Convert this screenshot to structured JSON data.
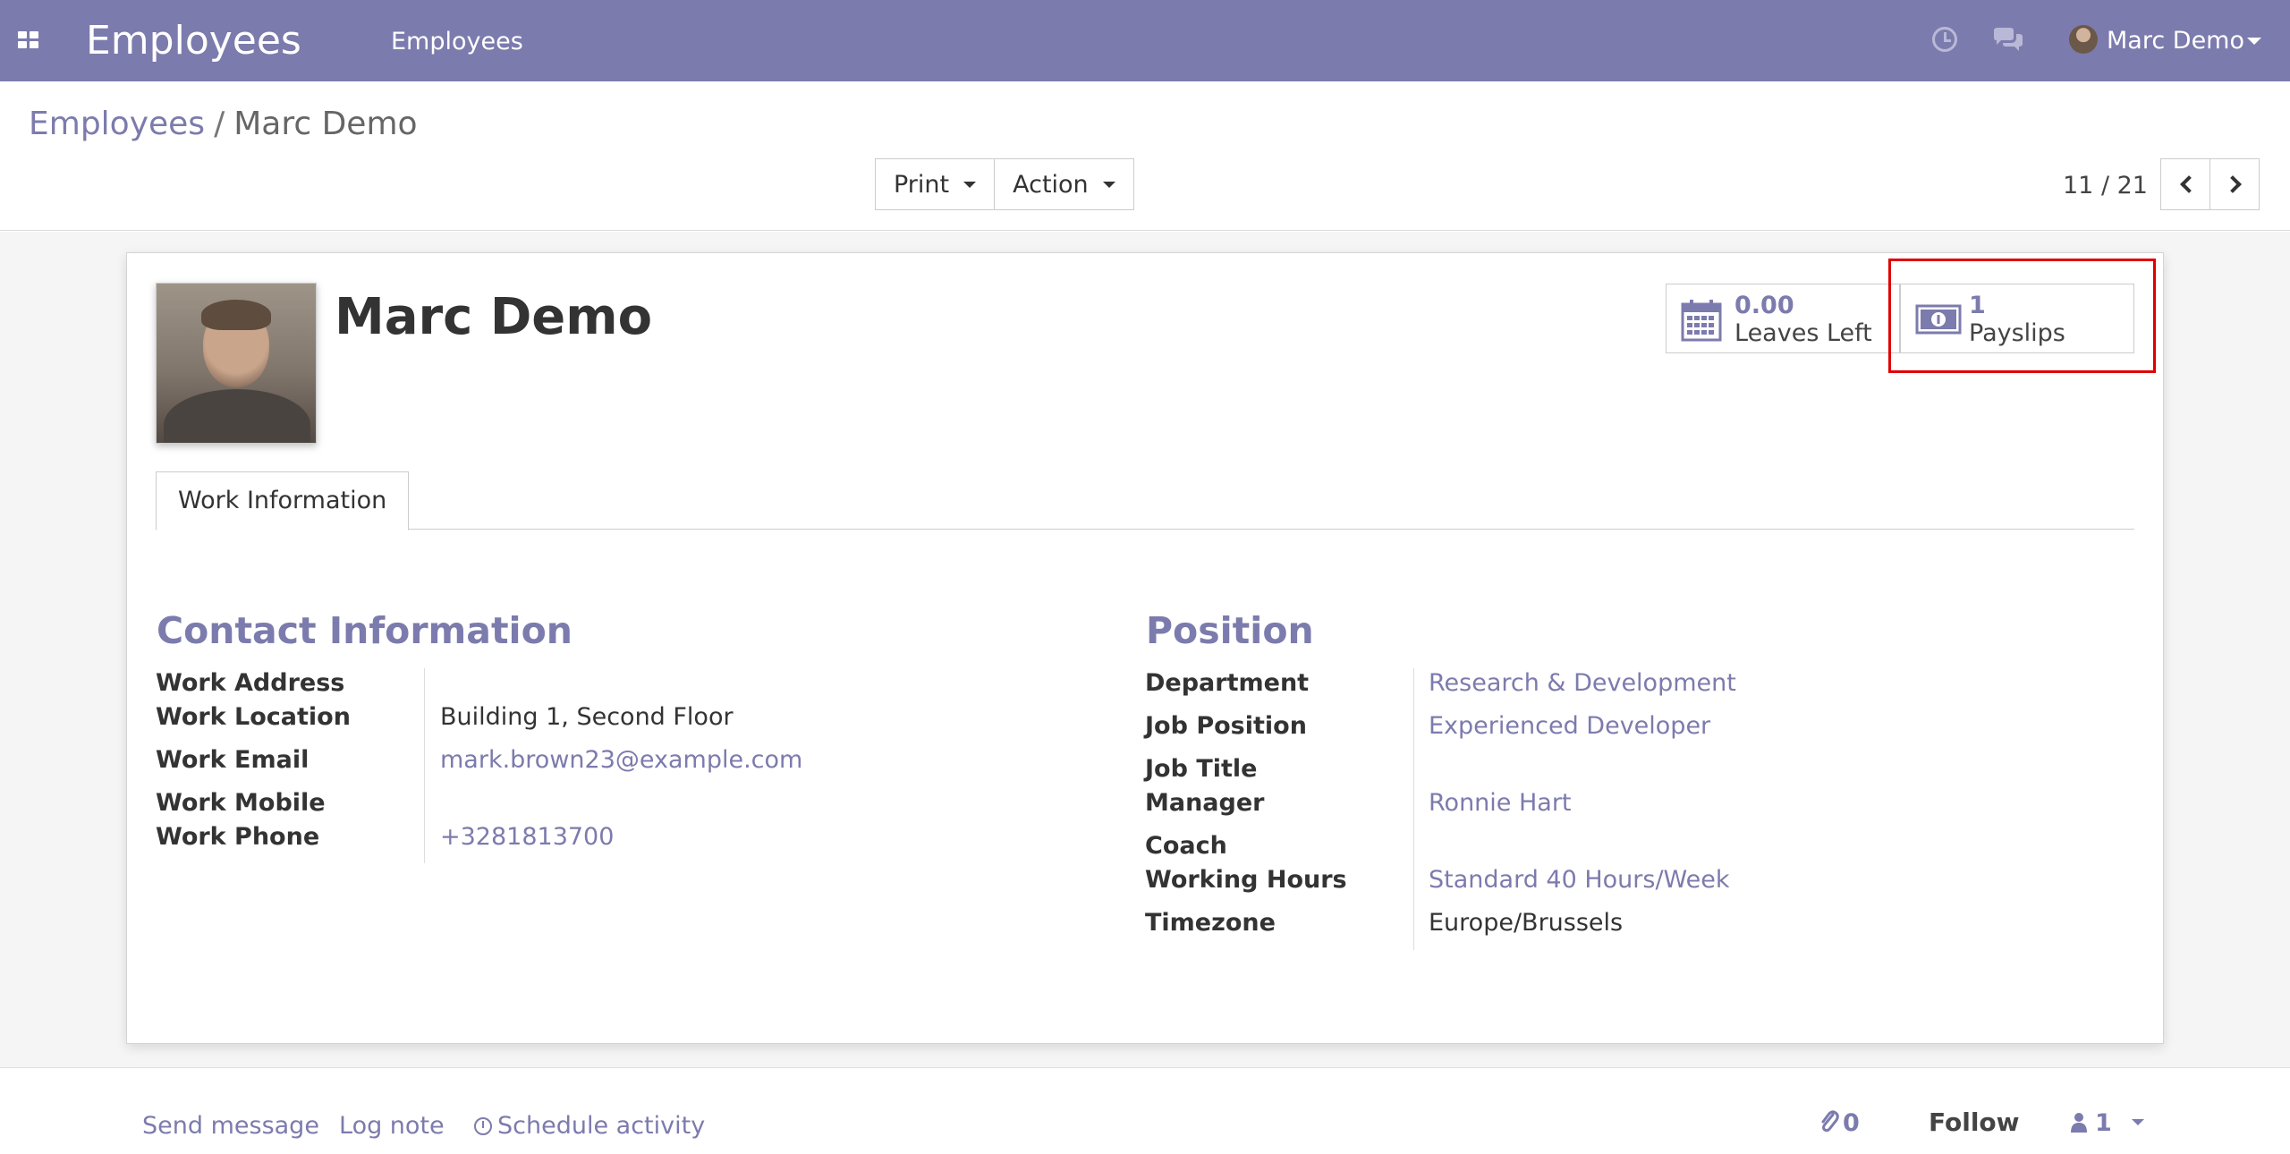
{
  "navbar": {
    "brand": "Employees",
    "menu_item": "Employees",
    "user_name": "Marc Demo",
    "icons": [
      "apps-grid-icon",
      "clock-icon",
      "chat-bubbles-icon",
      "user-avatar"
    ]
  },
  "breadcrumb": {
    "parent": "Employees",
    "separator": "/",
    "current": "Marc Demo"
  },
  "toolbar": {
    "print_label": "Print",
    "action_label": "Action"
  },
  "pager": {
    "value": "11 / 21"
  },
  "employee": {
    "name": "Marc Demo"
  },
  "stat_buttons": {
    "leaves": {
      "value": "0.00",
      "label": "Leaves Left",
      "icon": "calendar-icon"
    },
    "payslips": {
      "value": "1",
      "label": "Payslips",
      "icon": "money-icon"
    }
  },
  "tabs": [
    {
      "label": "Work Information",
      "active": true
    }
  ],
  "contact": {
    "title": "Contact Information",
    "labels": {
      "work_address": "Work Address",
      "work_location": "Work Location",
      "work_email": "Work Email",
      "work_mobile": "Work Mobile",
      "work_phone": "Work Phone"
    },
    "values": {
      "work_address": "",
      "work_location": "Building 1, Second Floor",
      "work_email": "mark.brown23@example.com",
      "work_mobile": "",
      "work_phone": "+3281813700"
    }
  },
  "position": {
    "title": "Position",
    "labels": {
      "department": "Department",
      "job_position": "Job Position",
      "job_title": "Job Title",
      "manager": "Manager",
      "coach": "Coach",
      "working_hours": "Working Hours",
      "timezone": "Timezone"
    },
    "values": {
      "department": "Research & Development",
      "job_position": "Experienced Developer",
      "job_title": "",
      "manager": "Ronnie Hart",
      "coach": "",
      "working_hours": "Standard 40 Hours/Week",
      "timezone": "Europe/Brussels"
    }
  },
  "chatter": {
    "send_message": "Send message",
    "log_note": "Log note",
    "schedule_activity": "Schedule activity",
    "attachments_count": "0",
    "follow_label": "Follow",
    "followers_count": "1"
  },
  "colors": {
    "brand": "#7c7bad",
    "highlight": "#e00000"
  }
}
